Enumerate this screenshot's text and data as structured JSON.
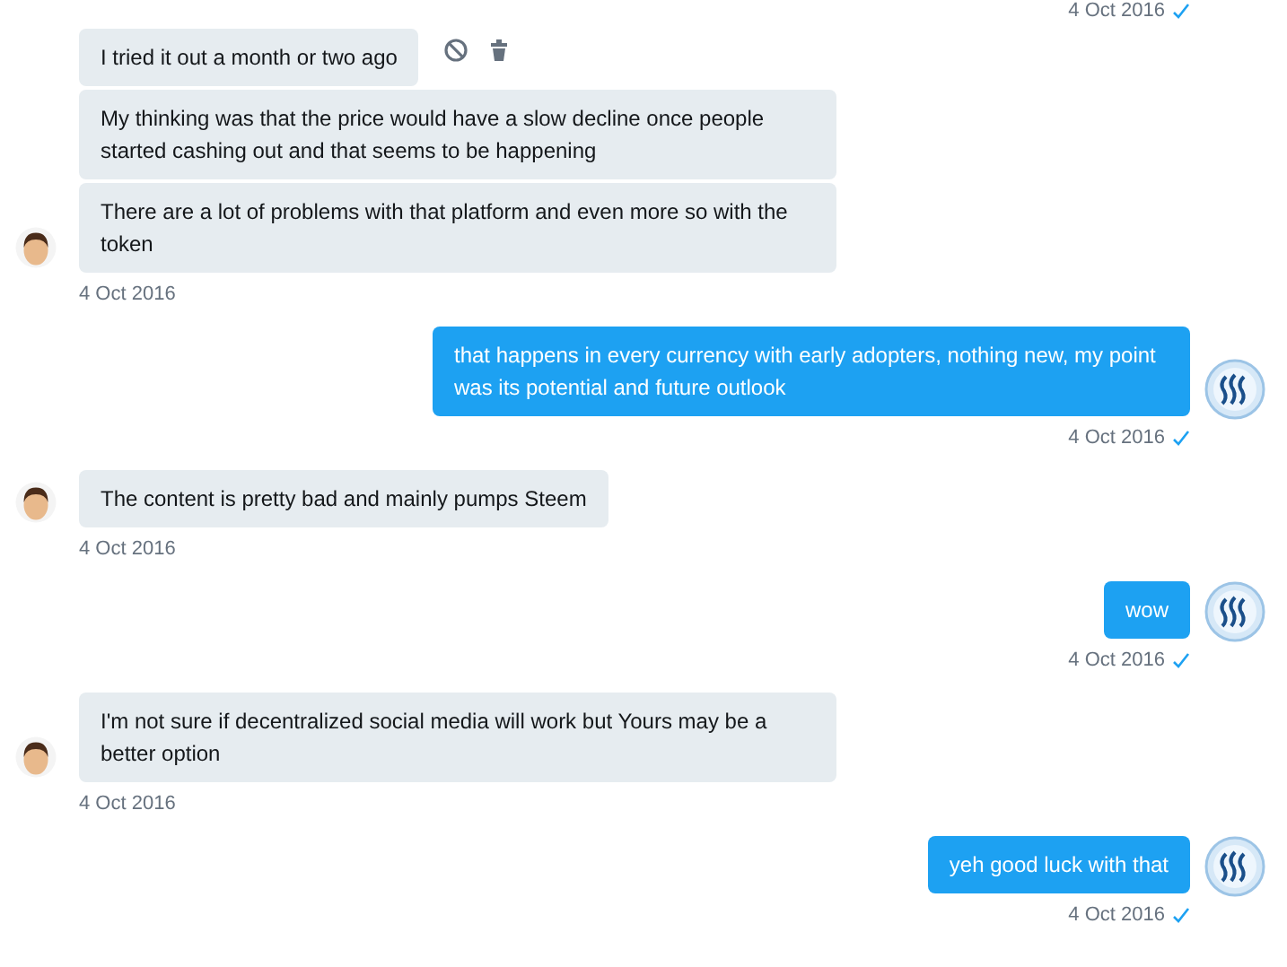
{
  "top_status": {
    "time": "4 Oct 2016",
    "read": true
  },
  "groups": [
    {
      "kind": "incoming",
      "messages": [
        {
          "text": "I tried it out a month or two ago",
          "actions": true
        },
        {
          "text": "My thinking was that the price would have a slow decline once people started cashing out and that seems to be happening",
          "actions": false
        },
        {
          "text": "There are a lot of problems with that platform and even more so with the token",
          "actions": false
        }
      ],
      "time": "4 Oct 2016"
    },
    {
      "kind": "outgoing",
      "messages": [
        {
          "text": "that happens in every currency with early adopters, nothing new, my point was its potential and future outlook",
          "actions": false
        }
      ],
      "time": "4 Oct 2016",
      "read": true
    },
    {
      "kind": "incoming",
      "messages": [
        {
          "text": "The content is pretty bad and mainly pumps Steem",
          "actions": false
        }
      ],
      "time": "4 Oct 2016"
    },
    {
      "kind": "outgoing",
      "messages": [
        {
          "text": "wow",
          "actions": false
        }
      ],
      "time": "4 Oct 2016",
      "read": true
    },
    {
      "kind": "incoming",
      "messages": [
        {
          "text": "I'm not sure if decentralized social media will work but Yours may be a better option",
          "actions": false
        }
      ],
      "time": "4 Oct 2016"
    },
    {
      "kind": "outgoing",
      "messages": [
        {
          "text": "yeh good luck with that",
          "actions": false
        }
      ],
      "time": "4 Oct 2016",
      "read": true
    }
  ]
}
